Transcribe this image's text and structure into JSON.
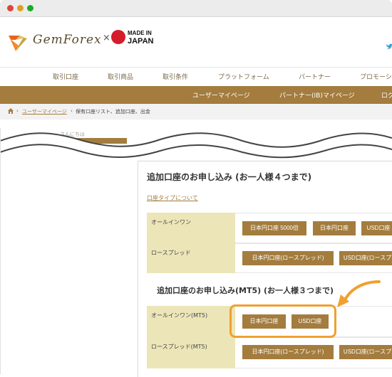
{
  "brand": {
    "logo_text": "GemForex",
    "times": "×",
    "made_in": "MADE IN",
    "japan": "JAPAN"
  },
  "nav_primary": [
    "取引口座",
    "取引商品",
    "取引条件",
    "プラットフォーム",
    "パートナー",
    "プロモーシ"
  ],
  "nav_secondary": [
    "ユーザーマイページ",
    "パートナー(IB)マイページ",
    "ログ"
  ],
  "breadcrumb": {
    "separator": "›",
    "link": "ユーザーマイページ",
    "current": "保有口座リスト、追加口座、出金"
  },
  "sidebar": {
    "greeting": "さんにちは"
  },
  "section1": {
    "title": "追加口座のお申し込み (お一人様４つまで)",
    "type_link": "口座タイプについて",
    "rows": [
      {
        "label": "オールインワン",
        "buttons": [
          "日本円口座 5000倍",
          "日本円口座",
          "USD口座"
        ]
      },
      {
        "label": "ロースプレッド",
        "buttons": [
          "日本円口座(ロースプレッド)",
          "USD口座(ロースプ"
        ]
      }
    ]
  },
  "section2": {
    "title": "追加口座のお申し込み(MT5) (お一人様３つまで)",
    "rows": [
      {
        "label": "オールインワン(MT5)",
        "buttons": [
          "日本円口座",
          "USD口座"
        ]
      },
      {
        "label": "ロースプレッド(MT5)",
        "buttons": [
          "日本円口座(ロースプレッド)",
          "USD口座(ロースプ"
        ]
      }
    ]
  },
  "colors": {
    "brand_gold": "#a37c3e",
    "label_bg": "#ece5b8",
    "highlight": "#f0a030",
    "japan_red": "#d41c2a"
  }
}
